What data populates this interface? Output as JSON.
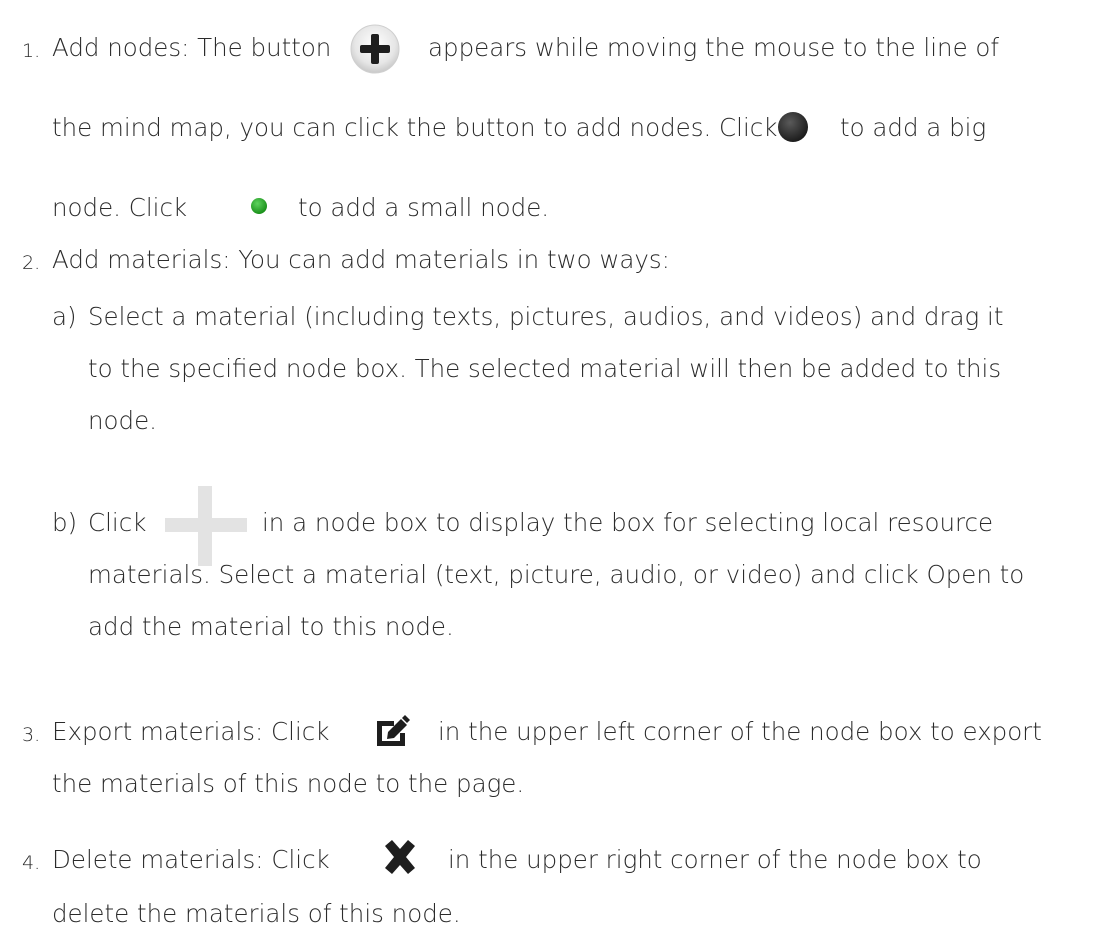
{
  "item1": {
    "number": "1.",
    "line1_before": "Add nodes: The button",
    "line1_after": "appears while moving the mouse to the line of",
    "line2_before": "the mind map, you can click the button to add nodes. Click",
    "line2_after": "to add a big",
    "line3_before": "node. Click",
    "line3_after": "to add a small node.",
    "icons": [
      "plus-circle-icon",
      "dark-dot-icon",
      "green-dot-icon"
    ]
  },
  "item2": {
    "number": "2.",
    "text": "Add materials: You can add materials in two ways:",
    "a": {
      "marker": "a)",
      "line1": "Select a material (including texts, pictures, audios, and videos) and drag it",
      "line2": "to the specified node box. The selected material will then be added to this",
      "line3": "node."
    },
    "b": {
      "marker": "b)",
      "line1_before": "Click",
      "line1_after": "in a node box to display the box for selecting local resource",
      "line2": "materials. Select a material (text, picture, audio, or video) and click Open to",
      "line3": "add the material to this node.",
      "icon": "light-plus-icon"
    }
  },
  "item3": {
    "number": "3.",
    "line1_before": "Export materials: Click",
    "line1_after": "in the upper left corner of the node box to export",
    "line2": "the materials of this node to the page.",
    "icon": "export-icon"
  },
  "item4": {
    "number": "4.",
    "line1_before": "Delete  materials:  Click",
    "line1_after": "in the upper right corner of the node box to",
    "line2": "delete the materials of this node.",
    "icon": "close-icon"
  },
  "colors": {
    "text": "#2b2b2b",
    "dark_dot": "#2a2a2a",
    "green_dot": "#2aa82a",
    "light_plus": "#e3e3e3"
  }
}
